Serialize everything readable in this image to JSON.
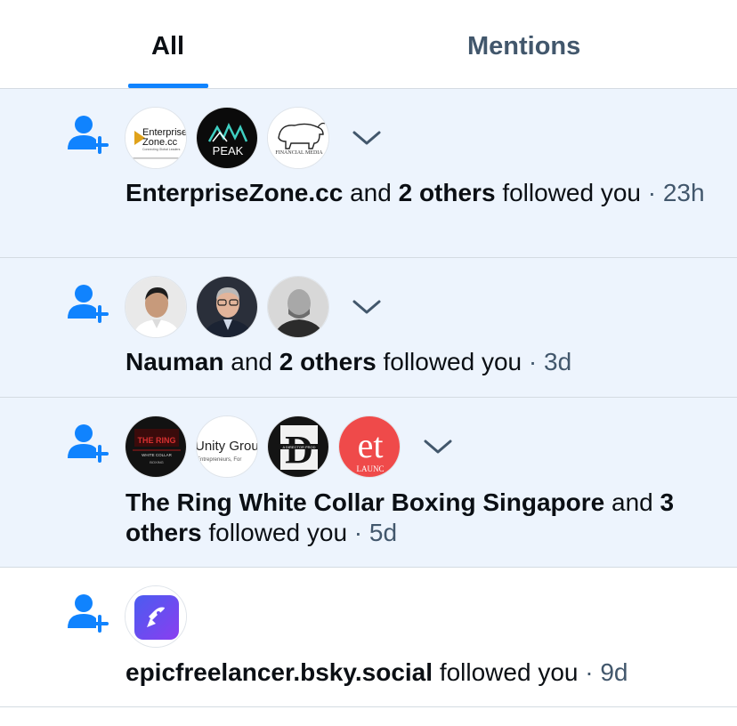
{
  "tabs": [
    {
      "label": "All",
      "active": true
    },
    {
      "label": "Mentions",
      "active": false
    }
  ],
  "colors": {
    "accent": "#1083fe",
    "unread_bg": "#edf4fd",
    "muted": "#42576c",
    "text": "#0b0f14"
  },
  "notifications": [
    {
      "actor": "EnterpriseZone.cc",
      "joiner": "and",
      "others": "2 others",
      "action": "followed you",
      "time": "· 23h",
      "unread": true,
      "avatars": [
        {
          "icon": "enterprisezone-logo",
          "line1": "Enterprise",
          "line2": "Zone.cc",
          "line3": "Connecting Global Leaders"
        },
        {
          "icon": "peak-logo",
          "text": "PEAK"
        },
        {
          "icon": "financial-media-logo",
          "text": "FINANCIAL MEDIA"
        }
      ]
    },
    {
      "actor": "Nauman",
      "joiner": "and",
      "others": "2 others",
      "action": "followed you",
      "time": "· 3d",
      "unread": true,
      "avatars": [
        {
          "icon": "person-photo"
        },
        {
          "icon": "person-photo"
        },
        {
          "icon": "person-photo"
        }
      ]
    },
    {
      "actor": "The Ring White Collar Boxing Singapore",
      "joiner": "and",
      "others": "3 others",
      "action": "followed you",
      "time": "· 5d",
      "unread": true,
      "avatars": [
        {
          "icon": "the-ring-logo",
          "line1": "THE RING",
          "line2": "WHITE COLLAR",
          "line3": "BOXING"
        },
        {
          "icon": "unity-group-logo",
          "line1": "Unity Grou",
          "line2": "Entrepreneurs, For"
        },
        {
          "icon": "d-logo",
          "line1": "D",
          "line2": "A DIRECTOR PROD"
        },
        {
          "icon": "et-launch-logo",
          "line1": "et",
          "line2": "LAUNC"
        }
      ]
    },
    {
      "actor": "epicfreelancer.bsky.social",
      "joiner": "",
      "others": "",
      "action": "followed you",
      "time": "· 9d",
      "unread": false,
      "avatars": [
        {
          "icon": "rocket-app-icon"
        }
      ]
    }
  ]
}
